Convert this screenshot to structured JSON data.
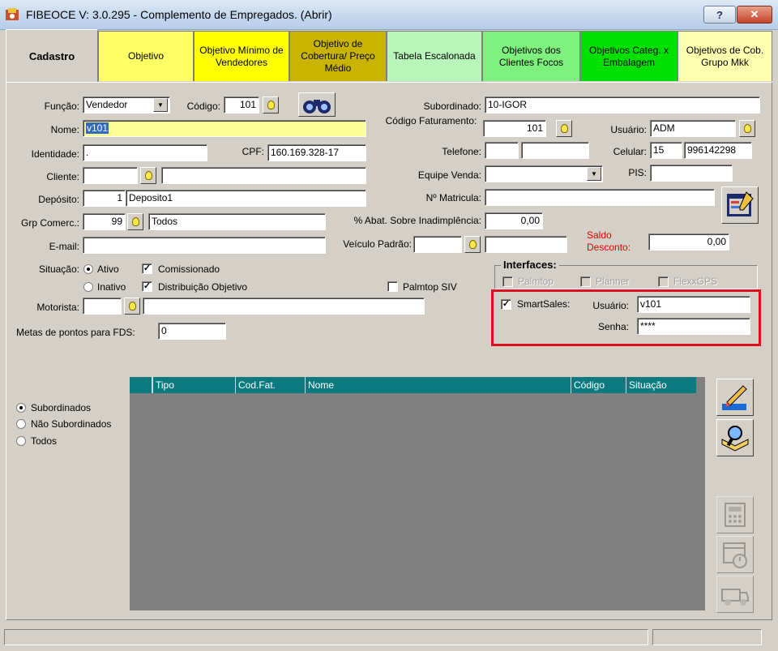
{
  "window": {
    "title": "FIBEOCE V: 3.0.295 - Complemento de Empregados. (Abrir)",
    "help_label": "?",
    "close_label": "✕"
  },
  "tabs": [
    {
      "label": "Cadastro",
      "bg": "#d4d0c8"
    },
    {
      "label": "Objetivo",
      "bg": "#ffff66"
    },
    {
      "label": "Objetivo Mínimo de Vendedores",
      "bg": "#ffff00"
    },
    {
      "label": "Objetivo de Cobertura/ Preço Médio",
      "bg": "#c8b400"
    },
    {
      "label": "Tabela Escalonada",
      "bg": "#b8f5b8"
    },
    {
      "label": "Objetivos dos Clientes Focos",
      "bg": "#7ef07e"
    },
    {
      "label": "Objetivos Categ. x Embalagem",
      "bg": "#00e000"
    },
    {
      "label": "Objetivos de Cob. Grupo Mkk",
      "bg": "#ffffb0"
    }
  ],
  "form": {
    "funcao_label": "Função:",
    "funcao_value": "Vendedor",
    "codigo_label": "Código:",
    "codigo_value": "101",
    "nome_label": "Nome:",
    "nome_value": "v101",
    "identidade_label": "Identidade:",
    "identidade_value": ".",
    "cpf_label": "CPF:",
    "cpf_value": "160.169.328-17",
    "cliente_label": "Cliente:",
    "cliente_value": "",
    "deposito_label": "Depósito:",
    "deposito_code": "1",
    "deposito_name": "Deposito1",
    "grp_label": "Grp Comerc.:",
    "grp_code": "99",
    "grp_name": "Todos",
    "email_label": "E-mail:",
    "email_value": "",
    "situacao_label": "Situação:",
    "ativo_label": "Ativo",
    "inativo_label": "Inativo",
    "comissionado_label": "Comissionado",
    "distribuicao_label": "Distribuição Objetivo",
    "palmtop_siv_label": "Palmtop SIV",
    "motorista_label": "Motorista:",
    "metas_label": "Metas de pontos para FDS:",
    "metas_value": "0",
    "subordinado_label": "Subordinado:",
    "subordinado_value": "10-IGOR",
    "cod_fat_label": "Código Faturamento:",
    "cod_fat_value": "101",
    "usuario_label": "Usuário:",
    "usuario_value": "ADM",
    "telefone_label": "Telefone:",
    "celular_label": "Celular:",
    "celular_ddd": "15",
    "celular_num": "996142298",
    "equipe_label": "Equipe Venda:",
    "pis_label": "PIS:",
    "matricula_label": "Nº Matricula:",
    "abat_label": "% Abat. Sobre Inadimplência:",
    "abat_value": "0,00",
    "veiculo_label": "Veículo Padrão:",
    "saldo_label": "Saldo Desconto:",
    "saldo_value": "0,00",
    "saldo_color": "#e00000"
  },
  "interfaces": {
    "title": "Interfaces:",
    "palmtop_label": "Palmtop",
    "planner_label": "Planner",
    "flexxgps_label": "FlexxGPS",
    "smartsales_label": "SmartSales:",
    "usuario_label": "Usuário:",
    "usuario_value": "v101",
    "senha_label": "Senha:",
    "senha_value": "****",
    "highlight_color": "#e01020"
  },
  "filter": {
    "subordinados": "Subordinados",
    "nao_subordinados": "Não Subordinados",
    "todos": "Todos"
  },
  "grid": {
    "columns": [
      "Tipo",
      "Cod.Fat.",
      "Nome",
      "Código",
      "Situação"
    ],
    "header_color": "#0a7a80"
  }
}
